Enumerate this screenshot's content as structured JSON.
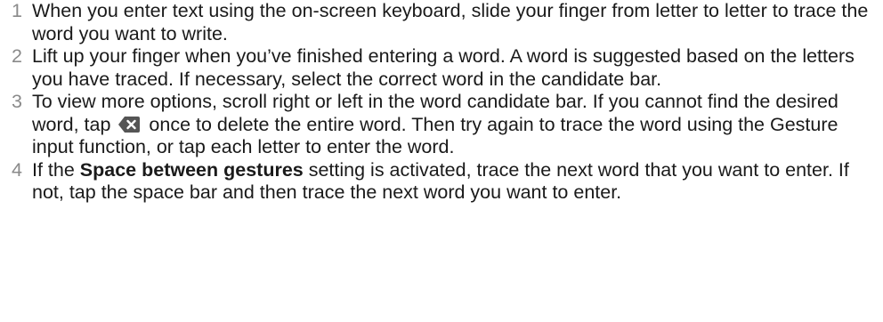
{
  "steps": [
    {
      "number": "1",
      "text": "When you enter text using the on-screen keyboard, slide your finger from letter to letter to trace the word you want to write."
    },
    {
      "number": "2",
      "text": "Lift up your finger when you’ve finished entering a word. A word is suggested based on the letters you have traced. If necessary, select the correct word in the candidate bar."
    },
    {
      "number": "3",
      "text_before_icon": "To view more options, scroll right or left in the word candidate bar. If you cannot find the desired word, tap",
      "icon": "backspace-delete-icon",
      "text_after_icon": "once to delete the entire word. Then try again to trace the word using the Gesture input function, or tap each letter to enter the word."
    },
    {
      "number": "4",
      "text_before_bold": "If the",
      "bold": "Space between gestures",
      "text_after_bold": "setting is activated, trace the next word that you want to enter. If not, tap the space bar and then trace the next word you want to enter."
    }
  ],
  "colors": {
    "text": "#1a1a1a",
    "number": "#8a8a8a",
    "icon": "#555555"
  }
}
